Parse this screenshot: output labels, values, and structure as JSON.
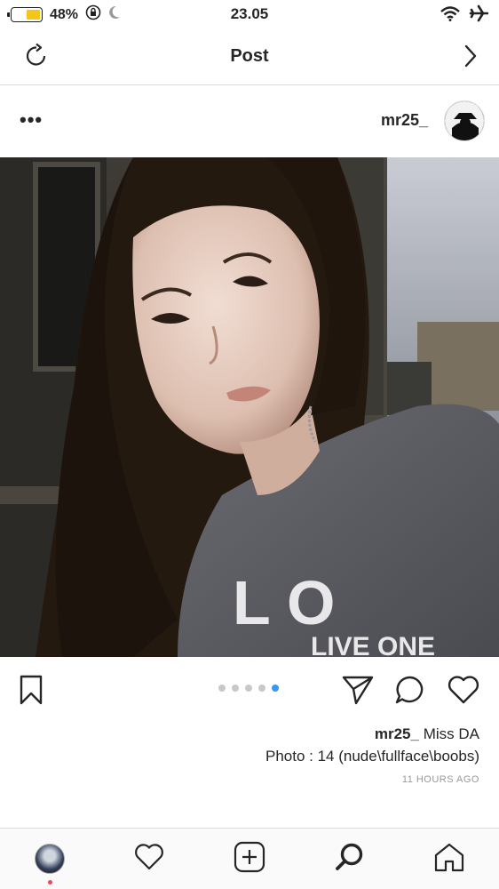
{
  "status_bar": {
    "battery_percent": "48%",
    "battery_level": 0.48,
    "time": "23.05",
    "icons": [
      "battery-icon",
      "orientation-lock-icon",
      "moon-icon",
      "wifi-icon",
      "airplane-icon"
    ]
  },
  "nav": {
    "title": "Post",
    "left_icon": "refresh-icon",
    "right_icon": "chevron-right-icon"
  },
  "post": {
    "username": "mr25_",
    "more_label": "•••",
    "carousel": {
      "count": 5,
      "active_index": 4
    },
    "caption_user": "mr25_",
    "caption_text": "Miss DA",
    "caption_line2": "Photo : 14 (nude\\fullface\\boobs)",
    "timestamp": "11 HOURS AGO",
    "shirt_text_1": "L O",
    "shirt_text_2": "LIVE ONE"
  },
  "colors": {
    "accent": "#3897f0",
    "notification": "#ed4956",
    "battery": "#f5c518"
  },
  "tabs": [
    "profile-tab",
    "activity-tab",
    "new-post-tab",
    "search-tab",
    "home-tab"
  ]
}
